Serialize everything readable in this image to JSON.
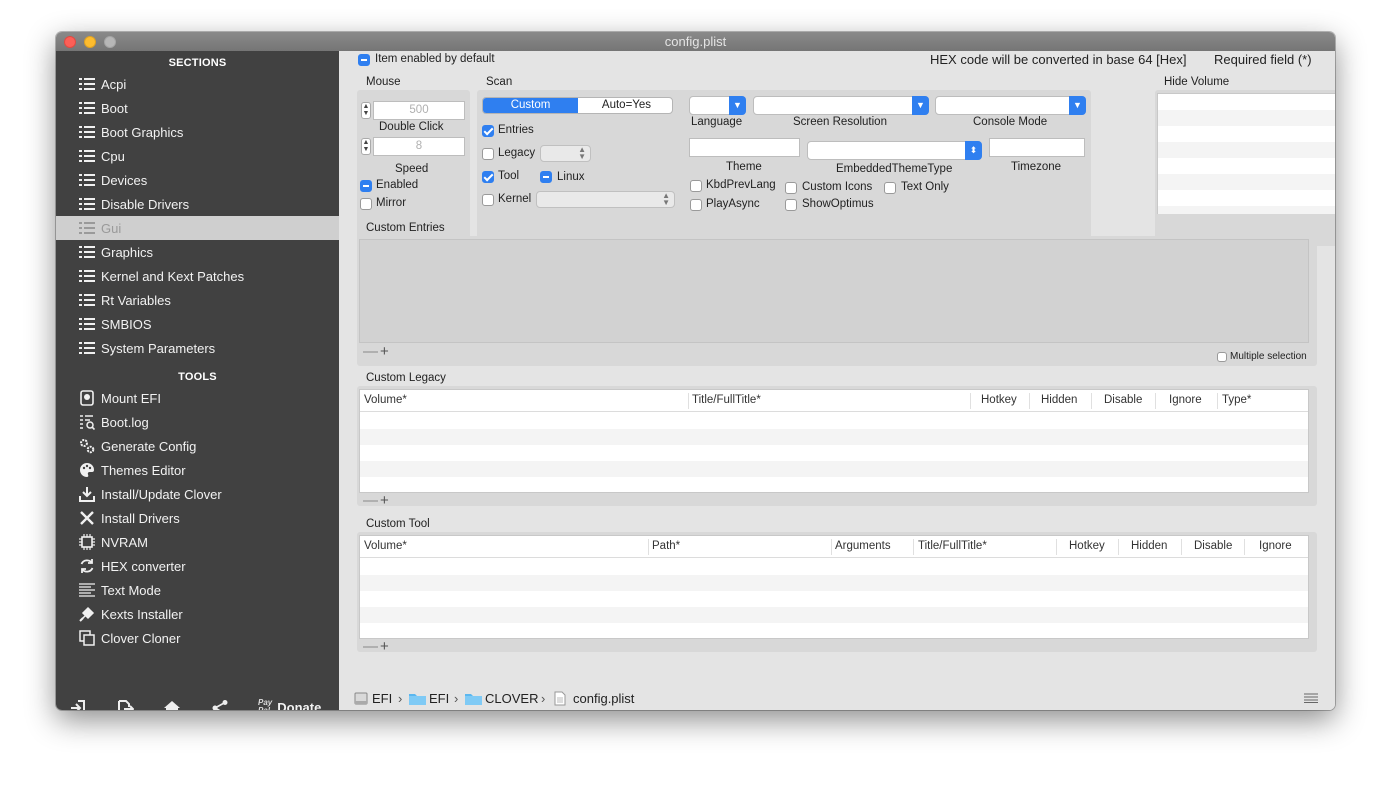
{
  "window": {
    "title": "config.plist"
  },
  "sidebar": {
    "sections_header": "SECTIONS",
    "sections": [
      {
        "label": "Acpi",
        "icon": "list-icon"
      },
      {
        "label": "Boot",
        "icon": "list-icon"
      },
      {
        "label": "Boot Graphics",
        "icon": "list-icon"
      },
      {
        "label": "Cpu",
        "icon": "list-icon"
      },
      {
        "label": "Devices",
        "icon": "list-icon"
      },
      {
        "label": "Disable Drivers",
        "icon": "list-icon"
      },
      {
        "label": "Gui",
        "icon": "list-icon",
        "selected": true
      },
      {
        "label": "Graphics",
        "icon": "list-icon"
      },
      {
        "label": "Kernel and Kext Patches",
        "icon": "list-icon"
      },
      {
        "label": "Rt Variables",
        "icon": "list-icon"
      },
      {
        "label": "SMBIOS",
        "icon": "list-icon"
      },
      {
        "label": "System Parameters",
        "icon": "list-icon"
      }
    ],
    "tools_header": "TOOLS",
    "tools": [
      {
        "label": "Mount EFI",
        "icon": "disk-icon"
      },
      {
        "label": "Boot.log",
        "icon": "log-icon"
      },
      {
        "label": "Generate Config",
        "icon": "gears-icon"
      },
      {
        "label": "Themes Editor",
        "icon": "palette-icon"
      },
      {
        "label": "Install/Update Clover",
        "icon": "download-icon"
      },
      {
        "label": "Install Drivers",
        "icon": "tools-icon"
      },
      {
        "label": "NVRAM",
        "icon": "chip-icon"
      },
      {
        "label": "HEX converter",
        "icon": "refresh-icon"
      },
      {
        "label": "Text Mode",
        "icon": "text-icon"
      },
      {
        "label": "Kexts Installer",
        "icon": "plug-icon"
      },
      {
        "label": "Clover Cloner",
        "icon": "clone-icon"
      }
    ],
    "footer": {
      "paypal": "Pay\nPal",
      "donate": "Donate"
    }
  },
  "top": {
    "item_enabled": "Item enabled by default",
    "hex_note": "HEX code will be converted in base 64 [Hex]",
    "required_note": "Required field (*)"
  },
  "mouse": {
    "title": "Mouse",
    "double_click_value": "500",
    "double_click_label": "Double Click",
    "speed_value": "8",
    "speed_label": "Speed",
    "enabled": "Enabled",
    "mirror": "Mirror"
  },
  "scan": {
    "title": "Scan",
    "seg_custom": "Custom",
    "seg_auto": "Auto=Yes",
    "entries": "Entries",
    "legacy": "Legacy",
    "tool": "Tool",
    "linux": "Linux",
    "kernel": "Kernel"
  },
  "gui": {
    "language": "Language",
    "screen_resolution": "Screen Resolution",
    "console_mode": "Console Mode",
    "theme": "Theme",
    "embedded_theme_type": "EmbeddedThemeType",
    "timezone": "Timezone",
    "kbd_prev_lang": "KbdPrevLang",
    "custom_icons": "Custom Icons",
    "text_only": "Text Only",
    "play_async": "PlayAsync",
    "show_optimus": "ShowOptimus"
  },
  "hide_volume": {
    "title": "Hide Volume"
  },
  "custom_entries": {
    "title": "Custom Entries",
    "multiple_selection": "Multiple selection"
  },
  "custom_legacy": {
    "title": "Custom Legacy",
    "columns": [
      "Volume*",
      "Title/FullTitle*",
      "Hotkey",
      "Hidden",
      "Disable",
      "Ignore",
      "Type*"
    ]
  },
  "custom_tool": {
    "title": "Custom Tool",
    "columns": [
      "Volume*",
      "Path*",
      "Arguments",
      "Title/FullTitle*",
      "Hotkey",
      "Hidden",
      "Disable",
      "Ignore"
    ]
  },
  "breadcrumb": [
    "EFI",
    "EFI",
    "CLOVER",
    "config.plist"
  ]
}
